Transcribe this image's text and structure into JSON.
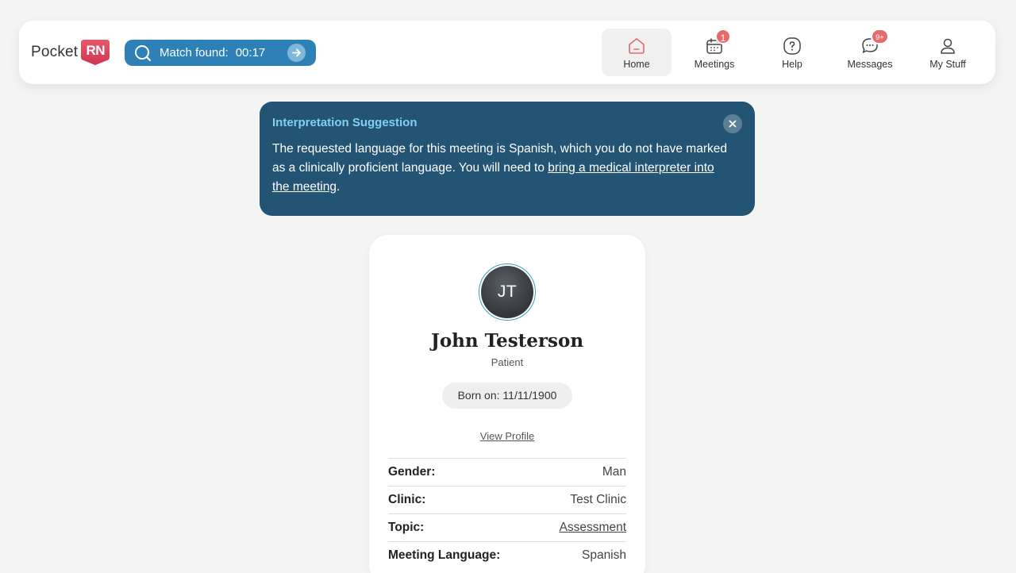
{
  "header": {
    "logo_text": "Pocket",
    "logo_badge": "RN",
    "match": {
      "label": "Match found:",
      "time": "00:17"
    },
    "nav": [
      {
        "label": "Home",
        "icon": "home-icon",
        "badge": null,
        "active": true
      },
      {
        "label": "Meetings",
        "icon": "calendar-icon",
        "badge": "1",
        "active": false
      },
      {
        "label": "Help",
        "icon": "help-icon",
        "badge": null,
        "active": false
      },
      {
        "label": "Messages",
        "icon": "chat-icon",
        "badge": "9+",
        "active": false
      },
      {
        "label": "My Stuff",
        "icon": "user-icon",
        "badge": null,
        "active": false
      }
    ]
  },
  "banner": {
    "title": "Interpretation Suggestion",
    "body_before": "The requested language for this meeting is Spanish, which you do not have marked as a clinically proficient language. You will need to ",
    "link_text": "bring a medical interpreter into the meeting",
    "body_after": "."
  },
  "patient": {
    "initials": "JT",
    "name": "John Testerson",
    "role": "Patient",
    "dob": "Born on: 11/11/1900",
    "view_profile": "View Profile",
    "details": [
      {
        "key": "Gender:",
        "value": "Man"
      },
      {
        "key": "Clinic:",
        "value": "Test Clinic"
      },
      {
        "key": "Topic:",
        "value": "Assessment"
      },
      {
        "key": "Meeting Language:",
        "value": "Spanish"
      }
    ]
  },
  "colors": {
    "accent_blue": "#2d81b6",
    "banner_bg": "#235473",
    "banner_title": "#7fd0f2",
    "badge_red": "#e56a6a",
    "logo_red": "#e0475e"
  }
}
